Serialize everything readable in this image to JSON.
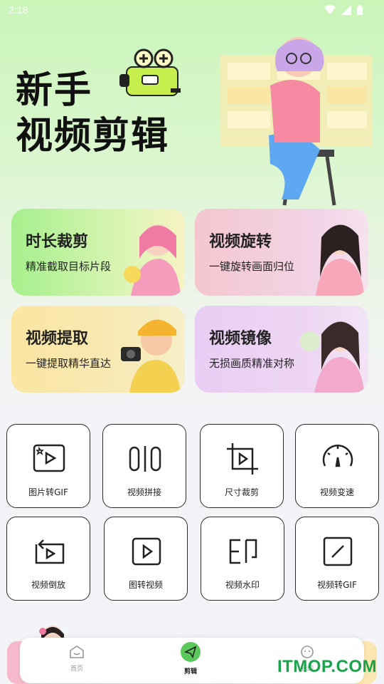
{
  "status_bar": {
    "time": "2:18"
  },
  "hero": {
    "title_line1": "新手",
    "title_line2": "视频剪辑"
  },
  "feature_cards": [
    {
      "title": "时长裁剪",
      "subtitle": "精准截取目标片段"
    },
    {
      "title": "视频旋转",
      "subtitle": "一键旋转画面归位"
    },
    {
      "title": "视频提取",
      "subtitle": "一键提取精华直达"
    },
    {
      "title": "视频镜像",
      "subtitle": "无损画质精准对称"
    }
  ],
  "tools": [
    {
      "label": "图片转GIF",
      "icon": "image-play-icon"
    },
    {
      "label": "视频拼接",
      "icon": "split-join-icon"
    },
    {
      "label": "尺寸裁剪",
      "icon": "crop-icon"
    },
    {
      "label": "视频变速",
      "icon": "speedometer-icon"
    },
    {
      "label": "视频倒放",
      "icon": "reverse-play-icon"
    },
    {
      "label": "图转视频",
      "icon": "play-box-icon"
    },
    {
      "label": "视频水印",
      "icon": "watermark-icon"
    },
    {
      "label": "视频转GIF",
      "icon": "video-gif-icon"
    }
  ],
  "bottom_nav": [
    {
      "label": "首页",
      "icon": "home-face-icon",
      "active": false
    },
    {
      "label": "剪辑",
      "icon": "send-icon",
      "active": true
    },
    {
      "label": "我的",
      "icon": "profile-icon",
      "active": false
    }
  ],
  "watermark": "ITMOP.COM",
  "colors": {
    "accent_green": "#5ac85a",
    "watermark": "#1aa34a"
  }
}
